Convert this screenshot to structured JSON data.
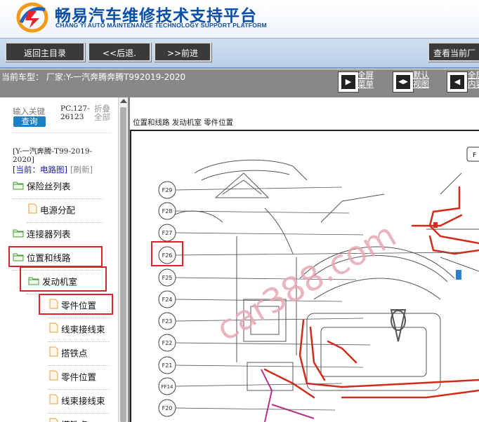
{
  "header": {
    "title_cn": "畅易汽车维修技术支持平台",
    "title_en": "CHANG YI AUTO MAINTENANCE TECHNOLOGY SUPPORT PLATFORM"
  },
  "nav": {
    "home": "返回主目录",
    "back": "<<后退.",
    "forward": ">>前进",
    "view_current": "查看当前厂"
  },
  "model": {
    "text": "当前车型： 厂家:Y-一汽奔腾奔腾T992019-2020",
    "views": [
      {
        "label": "全屏\n菜单"
      },
      {
        "label": "默认\n视图"
      },
      {
        "label": "全屏\n内容"
      }
    ]
  },
  "sidebar": {
    "search_placeholder": "输入关键",
    "query": "查询",
    "pc_code": "PC.127-\n26123",
    "fold_all": "折叠\n全部",
    "model_path": "[Y-一汽奔腾-T99-2019-\n2020]",
    "current": "[当前：电路图]",
    "refresh": "[刷新]",
    "tree": [
      {
        "label": "保险丝列表",
        "type": "folder"
      },
      {
        "label": "电源分配",
        "type": "file"
      },
      {
        "label": "连接器列表",
        "type": "folder"
      },
      {
        "label": "位置和线路",
        "type": "folder"
      },
      {
        "label": "发动机室",
        "type": "folder"
      },
      {
        "label": "零件位置",
        "type": "file"
      },
      {
        "label": "线束接线束",
        "type": "file"
      },
      {
        "label": "搭铁点",
        "type": "file"
      },
      {
        "label": "零件位置",
        "type": "file"
      },
      {
        "label": "线束接线束",
        "type": "file"
      },
      {
        "label": "搭铁点",
        "type": "file"
      }
    ]
  },
  "content": {
    "breadcrumb": "位置和线路 发动机室 零件位置",
    "watermark": "car388.com",
    "callouts": [
      "F29",
      "F28",
      "F27",
      "F26",
      "F25",
      "F24",
      "F23",
      "F22",
      "F21",
      "FF14",
      "F20"
    ],
    "top_right_tag": "F"
  },
  "colors": {
    "brand": "#0b4ea8",
    "highlight": "#e0222e",
    "harness": "#d42a1a",
    "watermark": "#e8a8b4"
  }
}
